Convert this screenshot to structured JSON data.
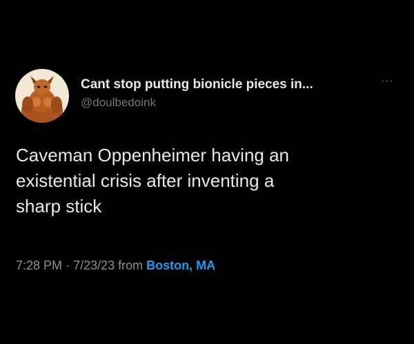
{
  "colors": {
    "background": "#000000",
    "primary_text": "#e7e9ea",
    "secondary_text": "#71767b",
    "link": "#1d9bf0"
  },
  "author": {
    "display_name": "Cant stop putting bionicle pieces in...",
    "handle": "@doulbedoink",
    "avatar_icon": "profile-avatar"
  },
  "more_menu": {
    "label": "···",
    "icon": "more-horizontal-icon"
  },
  "tweet": {
    "lines": [
      "Caveman Oppenheimer having an",
      "existential crisis after inventing a",
      "sharp stick"
    ]
  },
  "meta": {
    "time": "7:28 PM",
    "separator": "·",
    "date": "7/23/23",
    "from_label": "from",
    "source": "Boston, MA"
  }
}
